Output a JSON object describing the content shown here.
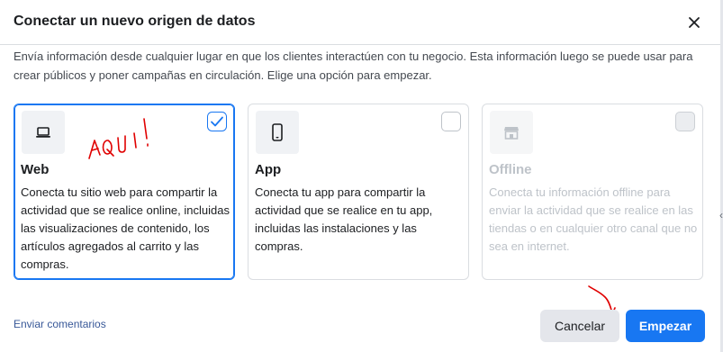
{
  "dialog": {
    "title": "Conectar un nuevo origen de datos",
    "description": "Envía información desde cualquier lugar en que los clientes interactúen con tu negocio. Esta información luego se puede usar para crear públicos y poner campañas en circulación. Elige una opción para empezar."
  },
  "options": [
    {
      "title": "Web",
      "text": "Conecta tu sitio web para compartir la actividad que se realice online, incluidas las visualizaciones de contenido, los artículos agregados al carrito y las compras.",
      "icon": "laptop-icon",
      "selected": true,
      "disabled": false
    },
    {
      "title": "App",
      "text": "Conecta tu app para compartir la actividad que se realice en tu app, incluidas las instalaciones y las compras.",
      "icon": "mobile-phone-icon",
      "selected": false,
      "disabled": false
    },
    {
      "title": "Offline",
      "text": "Conecta tu información offline para enviar la actividad que se realice en las tiendas o en cualquier otro canal que no sea en internet.",
      "icon": "store-icon",
      "selected": false,
      "disabled": true
    }
  ],
  "annotation": {
    "text": "AQUI!",
    "color": "#e00000"
  },
  "footer": {
    "feedback_label": "Enviar comentarios",
    "cancel_label": "Cancelar",
    "start_label": "Empezar"
  },
  "colors": {
    "accent": "#1877f2",
    "link": "#385898",
    "secondary_button": "#e4e6eb"
  }
}
